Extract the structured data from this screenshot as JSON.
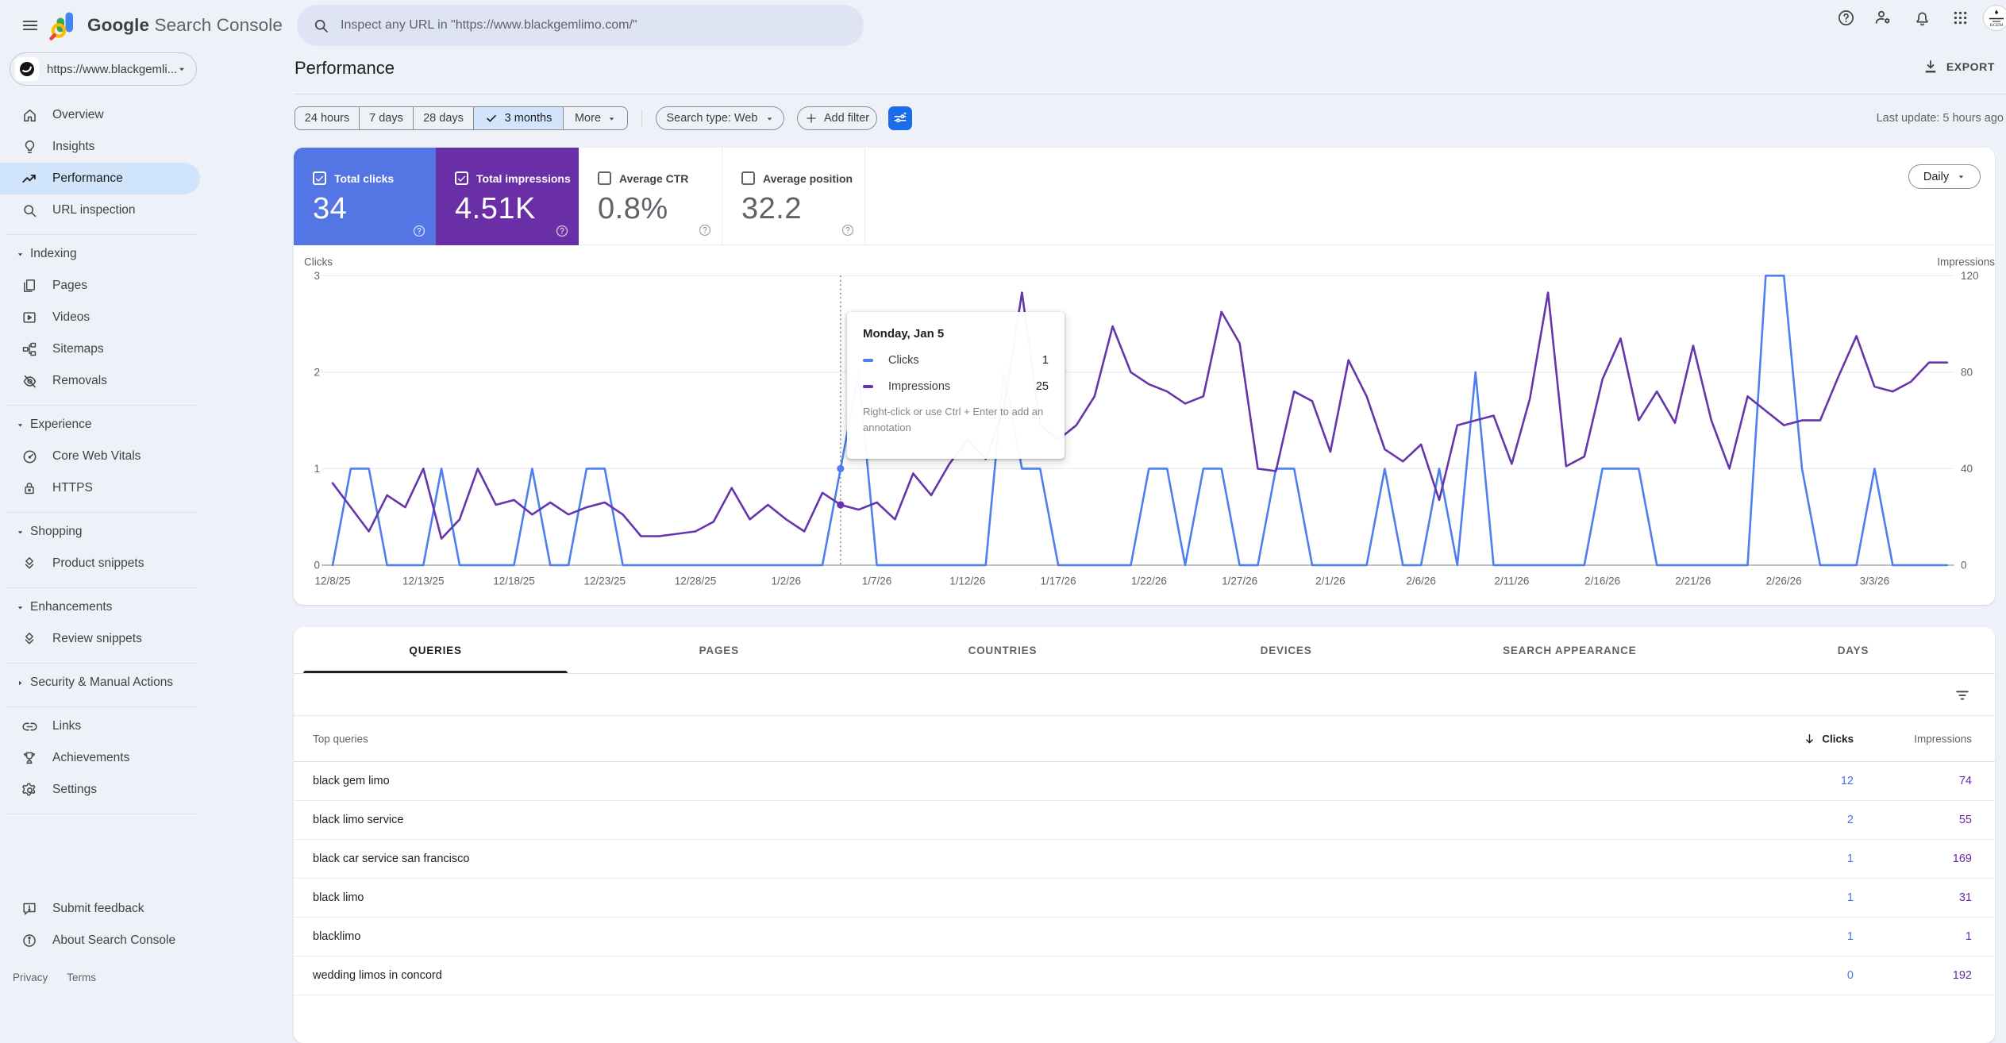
{
  "topbar": {
    "menu_icon": "hamburger-icon",
    "app_title_bold": "Google",
    "app_title_rest": " Search Console",
    "search_placeholder": "Inspect any URL in \"https://www.blackgemlimo.com/\"",
    "icons": [
      "help-icon",
      "user-settings-icon",
      "notifications-icon",
      "apps-grid-icon",
      "avatar"
    ]
  },
  "property_selector": {
    "label": "https://www.blackgemli..."
  },
  "sidebar": {
    "primary": [
      {
        "label": "Overview",
        "icon": "home"
      },
      {
        "label": "Insights",
        "icon": "lightbulb"
      },
      {
        "label": "Performance",
        "icon": "trending-up",
        "selected": true
      },
      {
        "label": "URL inspection",
        "icon": "search"
      }
    ],
    "groups": [
      {
        "label": "Indexing",
        "expanded": true,
        "items": [
          {
            "label": "Pages",
            "icon": "pages"
          },
          {
            "label": "Videos",
            "icon": "video"
          },
          {
            "label": "Sitemaps",
            "icon": "sitemap"
          },
          {
            "label": "Removals",
            "icon": "eye-off"
          }
        ]
      },
      {
        "label": "Experience",
        "expanded": true,
        "items": [
          {
            "label": "Core Web Vitals",
            "icon": "speed"
          },
          {
            "label": "HTTPS",
            "icon": "lock"
          }
        ]
      },
      {
        "label": "Shopping",
        "expanded": true,
        "items": [
          {
            "label": "Product snippets",
            "icon": "layers"
          }
        ]
      },
      {
        "label": "Enhancements",
        "expanded": true,
        "items": [
          {
            "label": "Review snippets",
            "icon": "layers"
          }
        ]
      },
      {
        "label": "Security & Manual Actions",
        "expanded": false,
        "items": []
      }
    ],
    "secondary": [
      {
        "label": "Links",
        "icon": "link"
      },
      {
        "label": "Achievements",
        "icon": "trophy"
      },
      {
        "label": "Settings",
        "icon": "gear"
      }
    ],
    "footer": [
      {
        "label": "Submit feedback",
        "icon": "feedback"
      },
      {
        "label": "About Search Console",
        "icon": "info"
      }
    ],
    "legal": [
      "Privacy",
      "Terms"
    ]
  },
  "page": {
    "title": "Performance",
    "export_label": "EXPORT",
    "last_update": "Last update: 5 hours ago"
  },
  "filters": {
    "date_ranges": [
      "24 hours",
      "7 days",
      "28 days",
      "3 months"
    ],
    "selected_range": "3 months",
    "more_label": "More",
    "search_type_label": "Search type: Web",
    "add_filter_label": "Add filter"
  },
  "metrics": [
    {
      "id": "clicks",
      "label": "Total clicks",
      "value": "34",
      "checked": true,
      "variant": "colored",
      "color": "#5376e4"
    },
    {
      "id": "impressions",
      "label": "Total impressions",
      "value": "4.51K",
      "checked": true,
      "variant": "colored",
      "color": "#6a2ea6"
    },
    {
      "id": "ctr",
      "label": "Average CTR",
      "value": "0.8%",
      "checked": false,
      "variant": "white"
    },
    {
      "id": "position",
      "label": "Average position",
      "value": "32.2",
      "checked": false,
      "variant": "white"
    }
  ],
  "chart_controls": {
    "granularity": "Daily"
  },
  "chart_data": {
    "type": "line",
    "title": "Clicks and impressions over time (daily)",
    "x": [
      "12/8/25",
      "12/9/25",
      "12/10/25",
      "12/11/25",
      "12/12/25",
      "12/13/25",
      "12/14/25",
      "12/15/25",
      "12/16/25",
      "12/17/25",
      "12/18/25",
      "12/19/25",
      "12/20/25",
      "12/21/25",
      "12/22/25",
      "12/23/25",
      "12/24/25",
      "12/25/25",
      "12/26/25",
      "12/27/25",
      "12/28/25",
      "12/29/25",
      "12/30/25",
      "12/31/25",
      "1/1/26",
      "1/2/26",
      "1/3/26",
      "1/4/26",
      "1/5/26",
      "1/6/26",
      "1/7/26",
      "1/8/26",
      "1/9/26",
      "1/10/26",
      "1/11/26",
      "1/12/26",
      "1/13/26",
      "1/14/26",
      "1/15/26",
      "1/16/26",
      "1/17/26",
      "1/18/26",
      "1/19/26",
      "1/20/26",
      "1/21/26",
      "1/22/26",
      "1/23/26",
      "1/24/26",
      "1/25/26",
      "1/26/26",
      "1/27/26",
      "1/28/26",
      "1/29/26",
      "1/30/26",
      "1/31/26",
      "2/1/26",
      "2/2/26",
      "2/3/26",
      "2/4/26",
      "2/5/26",
      "2/6/26",
      "2/7/26",
      "2/8/26",
      "2/9/26",
      "2/10/26",
      "2/11/26",
      "2/12/26",
      "2/13/26",
      "2/14/26",
      "2/15/26",
      "2/16/26",
      "2/17/26",
      "2/18/26",
      "2/19/26",
      "2/20/26",
      "2/21/26",
      "2/22/26",
      "2/23/26",
      "2/24/26",
      "2/25/26",
      "2/26/26",
      "2/27/26",
      "2/28/26",
      "3/1/26",
      "3/2/26",
      "3/3/26",
      "3/4/26",
      "3/5/26",
      "3/6/26",
      "3/7/26"
    ],
    "x_tick_every": 5,
    "left_axis": {
      "label": "Clicks",
      "ticks": [
        0,
        1,
        2,
        3
      ],
      "range": [
        0,
        3
      ]
    },
    "right_axis": {
      "label": "Impressions",
      "ticks": [
        0,
        40,
        80,
        120
      ],
      "range": [
        0,
        120
      ]
    },
    "grid": true,
    "series": [
      {
        "name": "Clicks",
        "axis": "left",
        "color": "#4d80ee",
        "values": [
          0,
          1,
          1,
          0,
          0,
          0,
          1,
          0,
          0,
          0,
          0,
          1,
          0,
          0,
          1,
          1,
          0,
          0,
          0,
          0,
          0,
          0,
          0,
          0,
          0,
          0,
          0,
          0,
          1,
          2,
          0,
          0,
          0,
          0,
          0,
          0,
          0,
          2,
          1,
          1,
          0,
          0,
          0,
          0,
          0,
          1,
          1,
          0,
          1,
          1,
          0,
          0,
          1,
          1,
          0,
          0,
          0,
          0,
          1,
          0,
          0,
          1,
          0,
          2,
          0,
          0,
          0,
          0,
          0,
          0,
          1,
          1,
          1,
          0,
          0,
          0,
          0,
          0,
          0,
          3,
          3,
          1,
          0,
          0,
          0,
          1,
          0,
          0,
          0,
          0
        ]
      },
      {
        "name": "Impressions",
        "axis": "right",
        "color": "#6435ab",
        "values": [
          34,
          24,
          14,
          29,
          24,
          40,
          11,
          19,
          40,
          25,
          27,
          21,
          26,
          21,
          24,
          26,
          21,
          12,
          12,
          13,
          14,
          18,
          32,
          19,
          25,
          19,
          14,
          30,
          25,
          23,
          26,
          19,
          38,
          29,
          42,
          52,
          44,
          65,
          113,
          58,
          52,
          58,
          70,
          99,
          80,
          75,
          72,
          67,
          70,
          105,
          92,
          40,
          39,
          72,
          68,
          47,
          85,
          70,
          48,
          43,
          50,
          27,
          58,
          60,
          62,
          42,
          69,
          113,
          41,
          45,
          77,
          94,
          60,
          72,
          59,
          91,
          60,
          40,
          70,
          64,
          58,
          60,
          60,
          78,
          95,
          74,
          72,
          76,
          84,
          84
        ]
      }
    ],
    "annotation_index": 28
  },
  "tooltip": {
    "title": "Monday, Jan 5",
    "rows": [
      {
        "label": "Clicks",
        "value": "1",
        "color": "#4d80ee"
      },
      {
        "label": "Impressions",
        "value": "25",
        "color": "#6435ab"
      }
    ],
    "hint": "Right-click or use Ctrl + Enter to add an annotation"
  },
  "table": {
    "tabs": [
      "QUERIES",
      "PAGES",
      "COUNTRIES",
      "DEVICES",
      "SEARCH APPEARANCE",
      "DAYS"
    ],
    "active_tab": "QUERIES",
    "columns": {
      "dimension": "Top queries",
      "clicks": "Clicks",
      "impressions": "Impressions"
    },
    "sorted_by": "clicks",
    "rows": [
      {
        "query": "black gem limo",
        "clicks": 12,
        "impressions": 74
      },
      {
        "query": "black limo service",
        "clicks": 2,
        "impressions": 55
      },
      {
        "query": "black car service san francisco",
        "clicks": 1,
        "impressions": 169
      },
      {
        "query": "black limo",
        "clicks": 1,
        "impressions": 31
      },
      {
        "query": "blacklimo",
        "clicks": 1,
        "impressions": 1
      },
      {
        "query": "wedding limos in concord",
        "clicks": 0,
        "impressions": 192
      }
    ]
  }
}
